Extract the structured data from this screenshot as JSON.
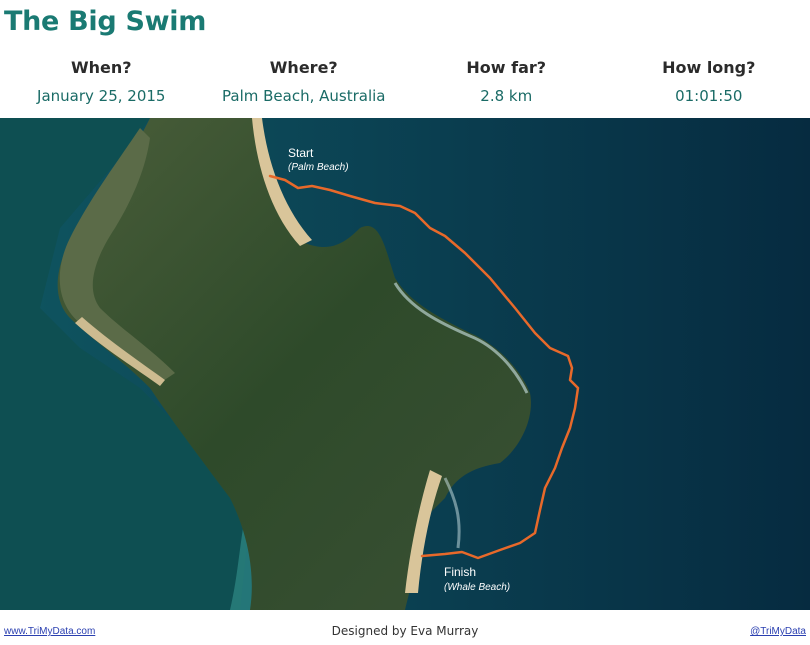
{
  "title": "The Big Swim",
  "stats": [
    {
      "label": "When?",
      "value": "January 25, 2015"
    },
    {
      "label": "Where?",
      "value": "Palm Beach, Australia"
    },
    {
      "label": "How far?",
      "value": "2.8 km"
    },
    {
      "label": "How long?",
      "value": "01:01:50"
    }
  ],
  "map": {
    "start_label": "Start",
    "start_sub": "(Palm Beach)",
    "finish_label": "Finish",
    "finish_sub": "(Whale Beach)",
    "route_color": "#e8692a",
    "ocean_color": "#0b3d52",
    "land_color": "#2c4a2a"
  },
  "footer": {
    "left_link": "www.TriMyData.com",
    "credit": "Designed by Eva Murray",
    "right_link": "@TriMyData"
  }
}
